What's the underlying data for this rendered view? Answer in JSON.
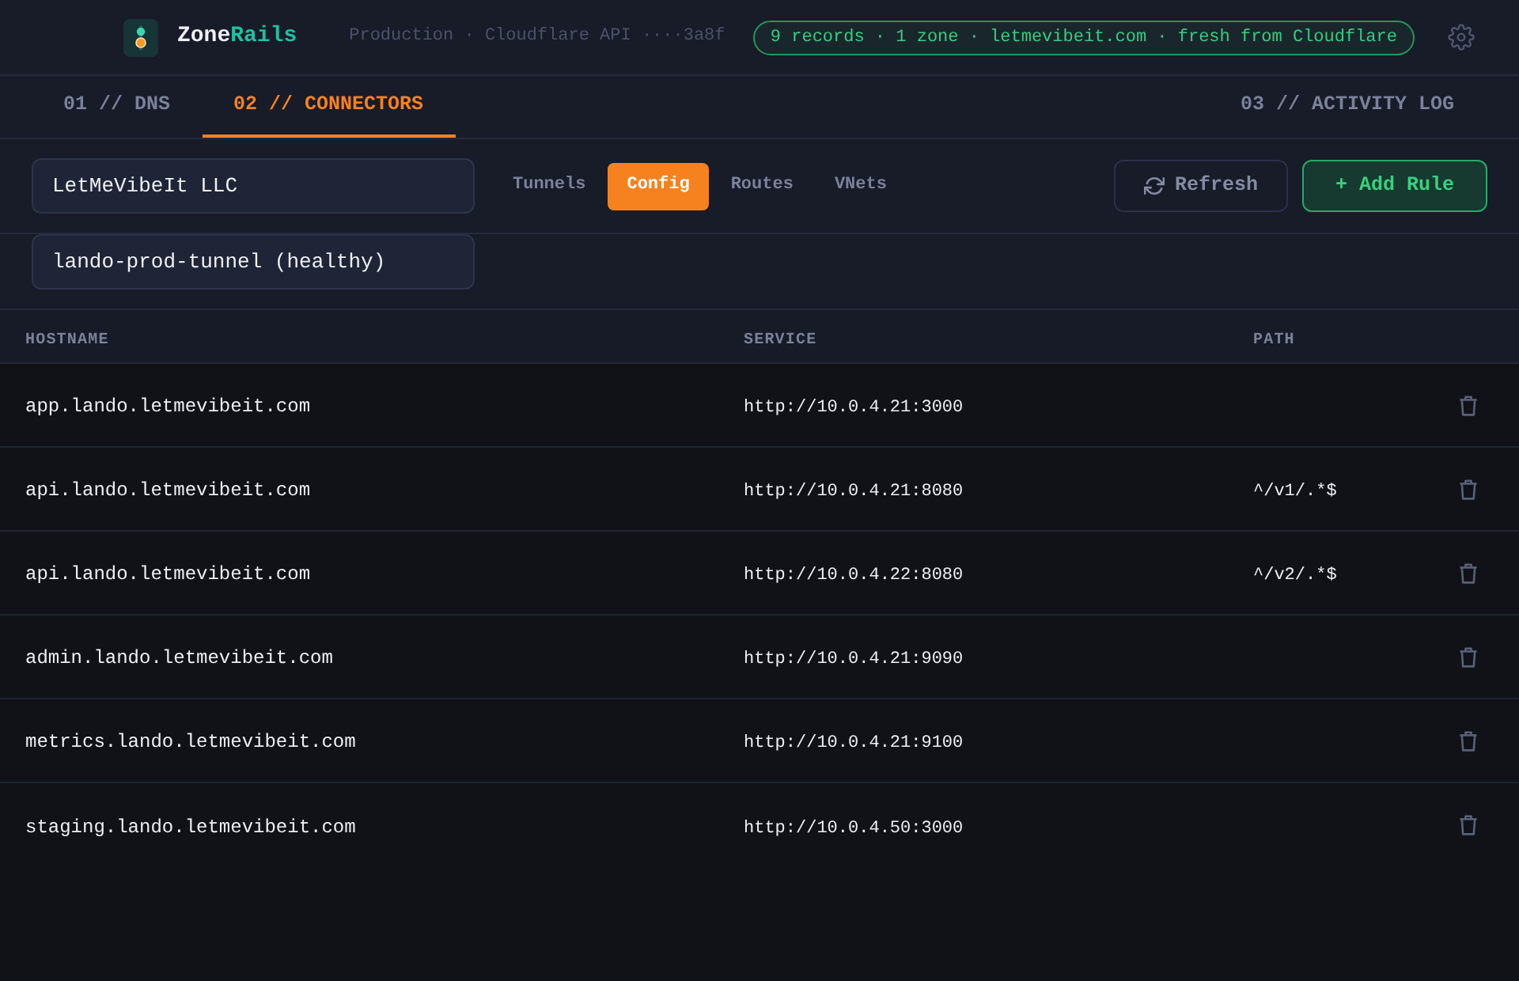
{
  "header": {
    "brand": {
      "name": "Zone",
      "accent": "Rails"
    },
    "connection": "Production · Cloudflare API ····3a8f",
    "status": "9 records · 1 zone · letmevibeit.com · fresh from Cloudflare"
  },
  "tabs": [
    {
      "label": "01 // DNS",
      "selected": false
    },
    {
      "label": "02 // CONNECTORS",
      "selected": true
    },
    {
      "label": "03 // ACTIVITY LOG",
      "selected": false
    }
  ],
  "toolbar": {
    "account": "LetMeVibeIt LLC",
    "views": [
      {
        "label": "Tunnels",
        "selected": false
      },
      {
        "label": "Config",
        "selected": true
      },
      {
        "label": "Routes",
        "selected": false
      },
      {
        "label": "VNets",
        "selected": false
      }
    ],
    "buttons": [
      {
        "kind": "refresh",
        "label": "Refresh"
      },
      {
        "kind": "add",
        "label": "+ Add Rule"
      }
    ]
  },
  "tunnel": "lando-prod-tunnel (healthy)",
  "table": {
    "columns": [
      "HOSTNAME",
      "SERVICE",
      "PATH"
    ],
    "rows": [
      {
        "hostname": "app.lando.letmevibeit.com",
        "service": "http://10.0.4.21:3000"
      },
      {
        "hostname": "api.lando.letmevibeit.com",
        "service": "http://10.0.4.21:8080",
        "path": "^/v1/.*$"
      },
      {
        "hostname": "api.lando.letmevibeit.com",
        "service": "http://10.0.4.22:8080",
        "path": "^/v2/.*$"
      },
      {
        "hostname": "admin.lando.letmevibeit.com",
        "service": "http://10.0.4.21:9090"
      },
      {
        "hostname": "metrics.lando.letmevibeit.com",
        "service": "http://10.0.4.21:9100"
      },
      {
        "hostname": "staging.lando.letmevibeit.com",
        "service": "http://10.0.4.50:3000"
      }
    ]
  }
}
